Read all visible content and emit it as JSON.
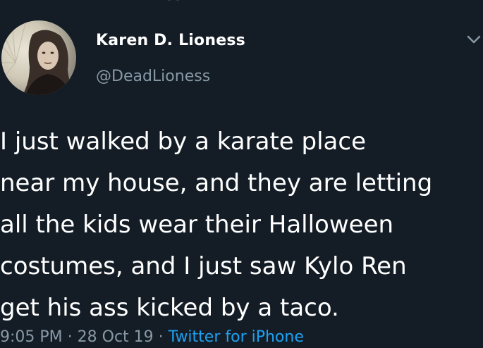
{
  "user": {
    "display_name": "Karen D. Lioness",
    "handle": "@DeadLioness"
  },
  "tweet": {
    "text": "I just walked by a karate place\nnear my house, and they are letting\nall the kids wear their Halloween\ncostumes, and I just saw Kylo Ren\nget his ass kicked by a taco."
  },
  "meta": {
    "time": "9:05 PM",
    "separator1": " · ",
    "date": "28 Oct 19",
    "separator2": " · ",
    "source": "Twitter for iPhone"
  },
  "icons": {
    "avatar": "profile-photo",
    "chevron": "chevron-down-icon"
  },
  "colors": {
    "background": "#141d26",
    "text": "#ffffff",
    "secondary": "#8899a6",
    "link": "#1da1f2"
  }
}
